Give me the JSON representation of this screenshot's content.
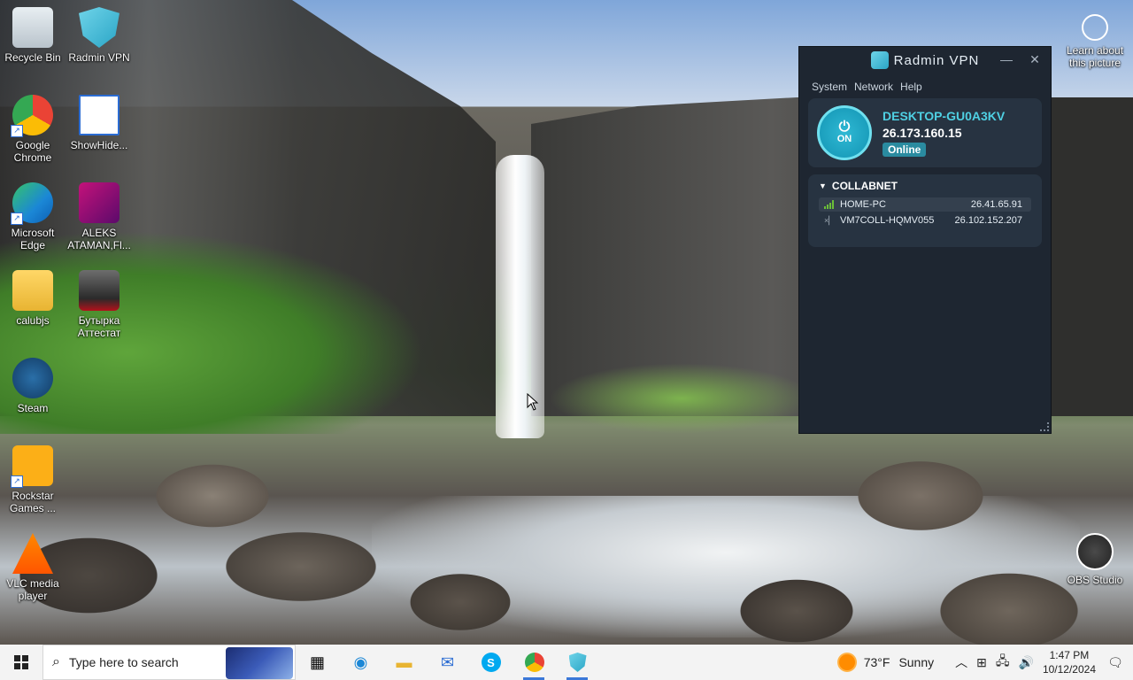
{
  "desktop": {
    "icons": [
      {
        "label": "Recycle Bin"
      },
      {
        "label": "Radmin VPN"
      },
      {
        "label": "Google Chrome"
      },
      {
        "label": "ShowHide..."
      },
      {
        "label": "Microsoft Edge"
      },
      {
        "label": "ALEKS ATAMAN,Fl..."
      },
      {
        "label": "calubjs"
      },
      {
        "label": "Бутырка Аттестат"
      },
      {
        "label": "Steam"
      },
      {
        "label": "Rockstar Games ..."
      },
      {
        "label": "VLC media player"
      },
      {
        "label": "OBS Studio"
      },
      {
        "label": "Learn about this picture"
      }
    ]
  },
  "radmin": {
    "title": "Radmin VPN",
    "menu": [
      "System",
      "Network",
      "Help"
    ],
    "power_label": "ON",
    "hostname": "DESKTOP-GU0A3KV",
    "ip": "26.173.160.15",
    "status": "Online",
    "network": {
      "name": "COLLABNET",
      "peers": [
        {
          "name": "HOME-PC",
          "ip": "26.41.65.91"
        },
        {
          "name": "VM7COLL-HQMV055",
          "ip": "26.102.152.207"
        }
      ]
    },
    "colors": {
      "accent": "#4fd0e3",
      "bg": "#1e2631",
      "card": "#273341"
    }
  },
  "taskbar": {
    "search_placeholder": "Type here to search",
    "weather": {
      "temp": "73°F",
      "condition": "Sunny"
    },
    "time": "1:47 PM",
    "date": "10/12/2024"
  }
}
